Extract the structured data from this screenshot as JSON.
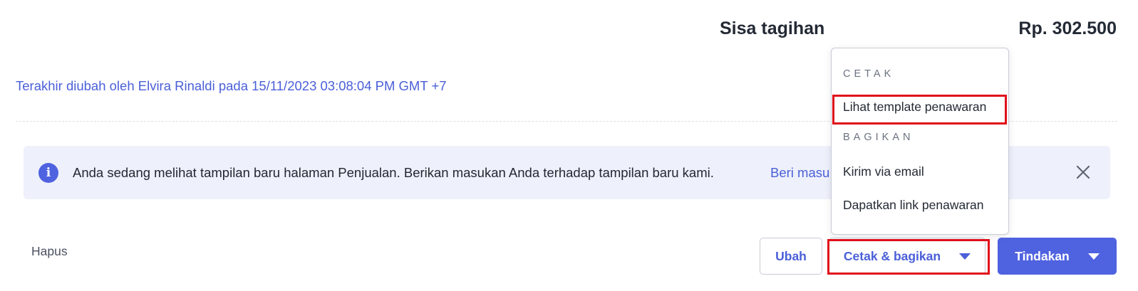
{
  "summary": {
    "label": "Sisa tagihan",
    "value": "Rp. 302.500"
  },
  "audit": {
    "text": "Terakhir diubah oleh Elvira Rinaldi pada 15/11/2023 03:08:04 PM GMT +7"
  },
  "banner": {
    "icon": "info-icon",
    "icon_glyph": "i",
    "message": "Anda sedang melihat tampilan baru halaman Penjualan. Berikan masukan Anda terhadap tampilan baru kami.",
    "feedback_link": "Beri masu"
  },
  "dropdown": {
    "sections": [
      {
        "heading": "CETAK",
        "items": [
          "Lihat template penawaran"
        ]
      },
      {
        "heading": "BAGIKAN",
        "items": [
          "Kirim via email",
          "Dapatkan link penawaran"
        ]
      }
    ]
  },
  "footer": {
    "delete_label": "Hapus",
    "edit_label": "Ubah",
    "print_share_label": "Cetak & bagikan",
    "actions_label": "Tindakan"
  },
  "colors": {
    "accent": "#4f62e0",
    "link": "#4a5fd8",
    "banner_bg": "#eef0fb",
    "highlight": "#e0101a"
  }
}
